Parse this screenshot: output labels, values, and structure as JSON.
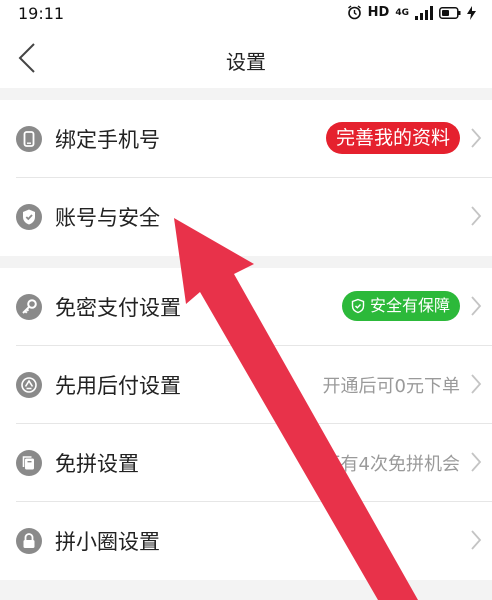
{
  "status_bar": {
    "time": "19:11",
    "hd": "HD",
    "network": "4G"
  },
  "header": {
    "title": "设置"
  },
  "settings": {
    "phone": {
      "label": "绑定手机号",
      "badge": "完善我的资料"
    },
    "account": {
      "label": "账号与安全"
    },
    "password_free": {
      "label": "免密支付设置",
      "badge": "安全有保障"
    },
    "pay_later": {
      "label": "先用后付设置",
      "value": "开通后可0元下单"
    },
    "free_group": {
      "label": "免拼设置",
      "value": "还有4次免拼机会"
    },
    "circle": {
      "label": "拼小圈设置"
    }
  },
  "colors": {
    "badge_red": "#e5212e",
    "badge_green": "#2cb93a",
    "arrow": "#e8324a"
  },
  "icons": {
    "phone": "phone-icon",
    "account": "shield-check-icon",
    "password_free": "key-icon",
    "pay_later": "pay-later-icon",
    "free_group": "pages-icon",
    "circle": "lock-icon"
  }
}
